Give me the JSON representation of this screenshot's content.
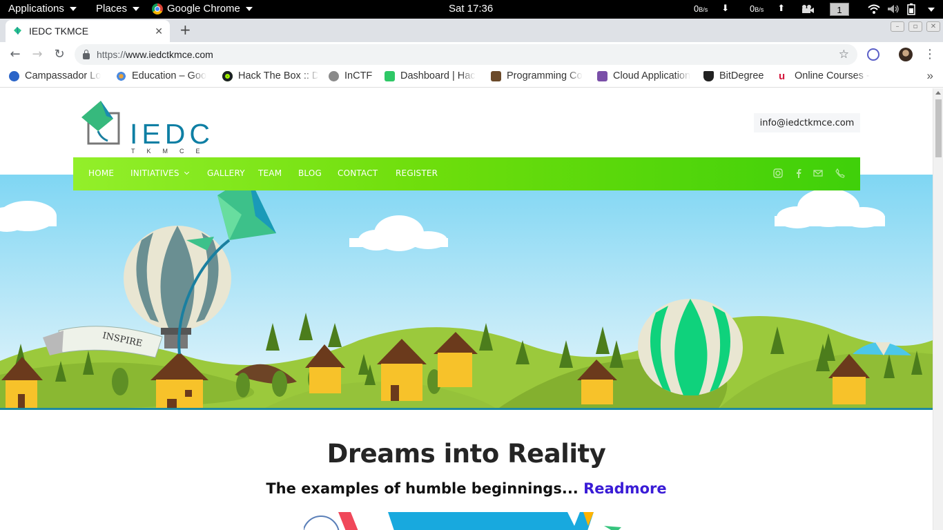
{
  "system_bar": {
    "applications_label": "Applications",
    "places_label": "Places",
    "app_label": "Google Chrome",
    "clock": "Sat 17:36",
    "net_down_value": "0",
    "net_down_unit": "B/s",
    "net_up_value": "0",
    "net_up_unit": "B/s",
    "workspace": "1"
  },
  "browser": {
    "tab_title": "IEDC TKMCE",
    "url_scheme": "https://",
    "url_host": "www.iedctkmce.com",
    "bookmarks": [
      {
        "label": "Campassador Lo",
        "color": "#2a64c8"
      },
      {
        "label": "Education – Goo",
        "color": "#e8a33c"
      },
      {
        "label": "Hack The Box :: D",
        "color": "#1b2026"
      },
      {
        "label": "InCTF",
        "color": "#8a8a8a"
      },
      {
        "label": "Dashboard | Hac",
        "color": "#2ec866"
      },
      {
        "label": "Programming Co",
        "color": "#6b4a2a"
      },
      {
        "label": "Cloud Application",
        "color": "#7a4fa8"
      },
      {
        "label": "BitDegree",
        "color": "#222222"
      },
      {
        "label": "Online Courses -",
        "color": "#d4163c"
      }
    ]
  },
  "site": {
    "logo_main": "IEDC",
    "logo_sub": "TKMCE",
    "email": "info@iedctkmce.com",
    "nav": {
      "home": "HOME",
      "initiatives": "INITIATIVES",
      "gallery": "GALLERY",
      "team": "TEAM",
      "blog": "BLOG",
      "contact": "CONTACT",
      "register": "REGISTER"
    },
    "hero_banner_text": "INSPIRE",
    "headline": "Dreams into Reality",
    "tagline": "The examples of humble beginnings...",
    "readmore": "Readmore"
  },
  "colors": {
    "nav_gradient_start": "#93ef2a",
    "nav_gradient_end": "#3fd00a",
    "logo_blue": "#0e7fa4",
    "readmore": "#3a1cd6"
  }
}
